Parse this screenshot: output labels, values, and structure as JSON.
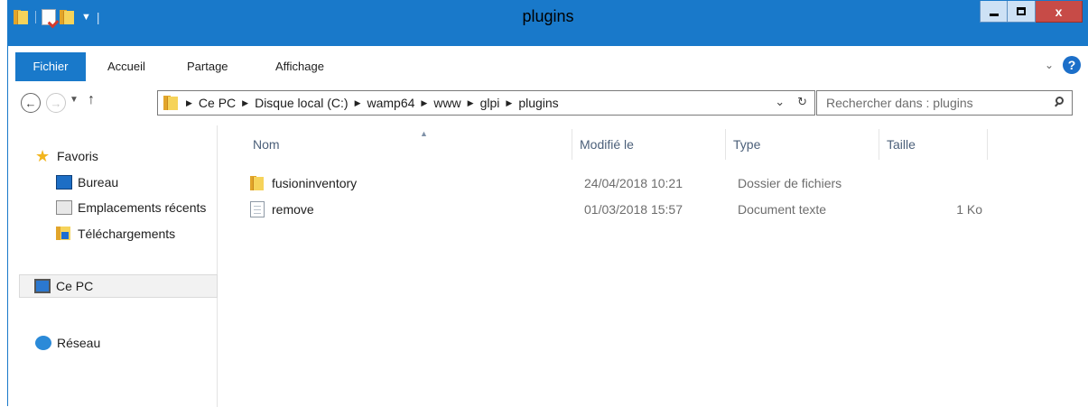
{
  "window": {
    "title": "plugins",
    "close_label": "x"
  },
  "ribbon": {
    "tabs": [
      "Fichier",
      "Accueil",
      "Partage",
      "Affichage"
    ],
    "help_label": "?"
  },
  "address": {
    "crumbs": [
      "Ce PC",
      "Disque local (C:)",
      "wamp64",
      "www",
      "glpi",
      "plugins"
    ],
    "search_placeholder": "Rechercher dans : plugins"
  },
  "nav": {
    "favorites": "Favoris",
    "items": [
      "Bureau",
      "Emplacements récents",
      "Téléchargements"
    ],
    "this_pc": "Ce PC",
    "network": "Réseau"
  },
  "columns": {
    "name": "Nom",
    "modified": "Modifié le",
    "type": "Type",
    "size": "Taille"
  },
  "files": [
    {
      "name": "fusioninventory",
      "modified": "24/04/2018 10:21",
      "type": "Dossier de fichiers",
      "size": "",
      "icon": "folder-icon"
    },
    {
      "name": "remove",
      "modified": "01/03/2018 15:57",
      "type": "Document texte",
      "size": "1 Ko",
      "icon": "text-file-icon"
    }
  ],
  "colors": {
    "accent": "#1979ca",
    "close": "#c74b47",
    "header_text": "#4c607a"
  }
}
